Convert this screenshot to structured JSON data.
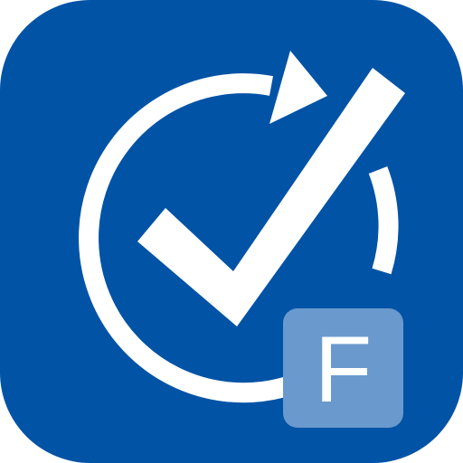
{
  "app_icon": {
    "background_color": "#0153a6",
    "glyph_color": "#ffffff",
    "glyph_icons": [
      "refresh-arrow-icon",
      "checkmark-icon"
    ],
    "badge": {
      "letter": "F",
      "background_color": "#6a99cd",
      "text_color": "#ffffff"
    }
  }
}
